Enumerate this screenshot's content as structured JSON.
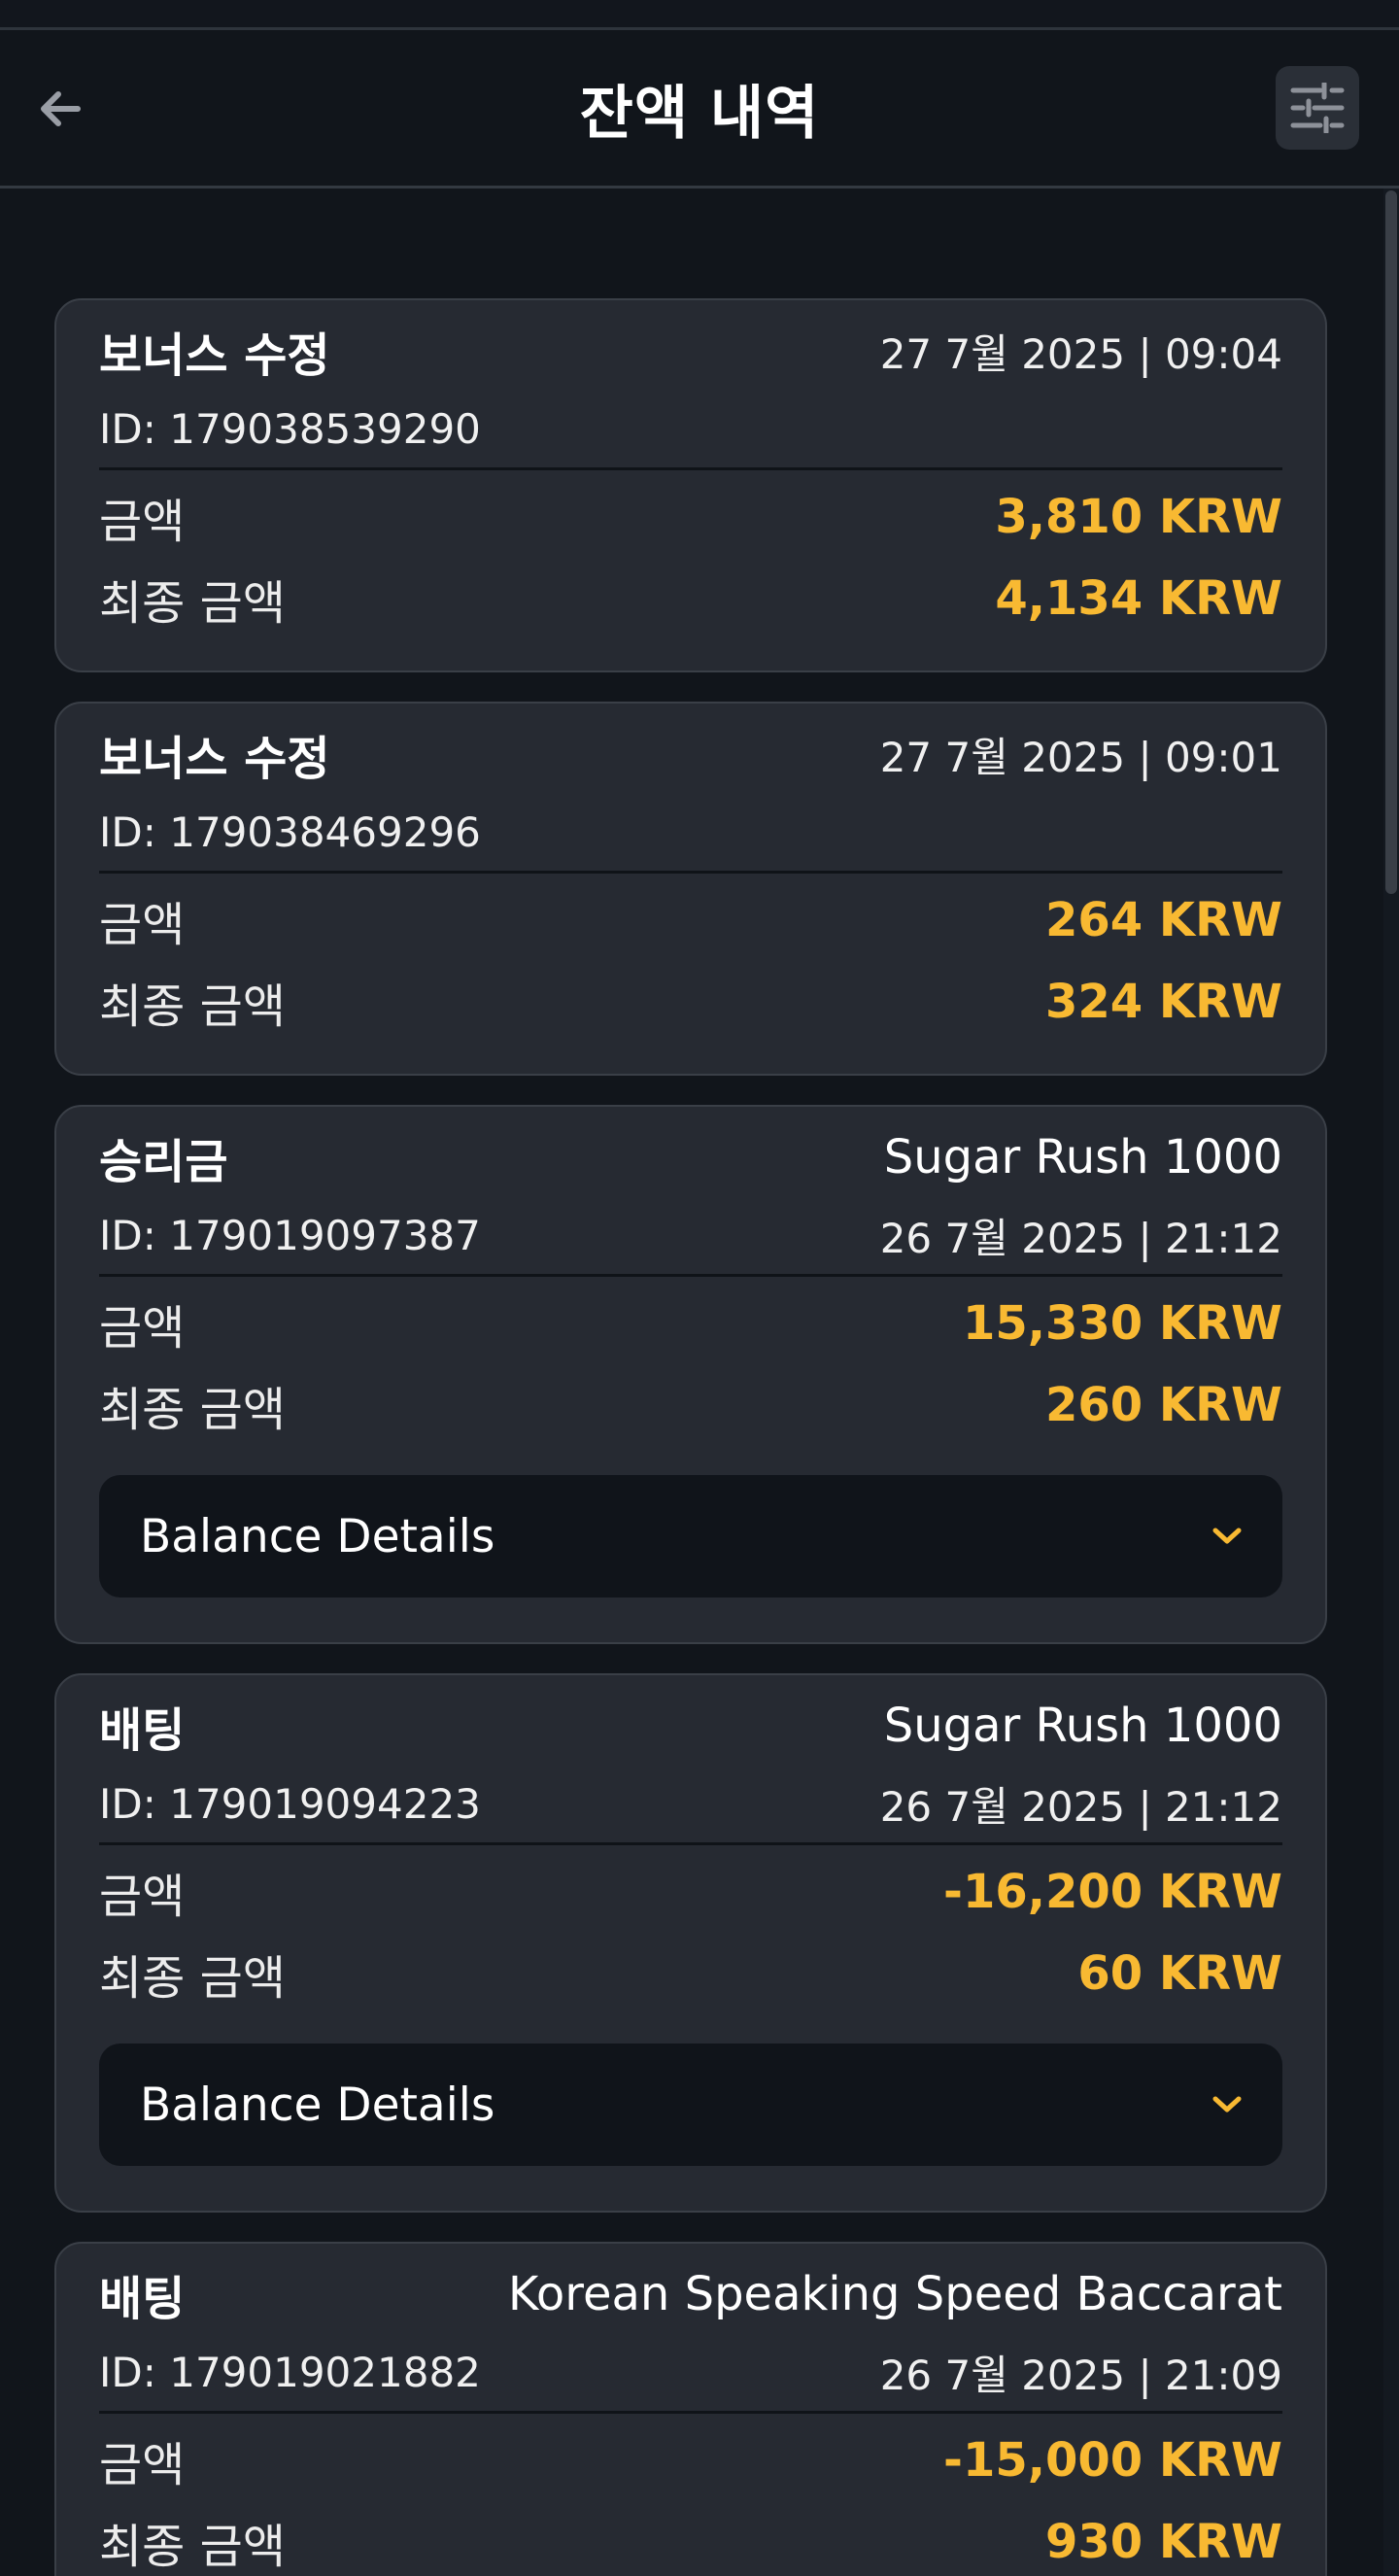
{
  "header": {
    "title": "잔액 내역",
    "back_icon": "arrow-left-icon",
    "filter_icon": "sliders-icon"
  },
  "colors": {
    "background": "#11151b",
    "card": "#262a32",
    "accent_amount": "#f8b932",
    "details_bar": "#10141a"
  },
  "transactions": [
    {
      "type": "보너스 수정",
      "game": "",
      "id_text": "ID: 179038539290",
      "date": "27 7월 2025 | 09:04",
      "amount_label": "금액",
      "amount": "3,810 KRW",
      "final_label": "최종 금액",
      "final_amount": "4,134 KRW",
      "details_label": ""
    },
    {
      "type": "보너스 수정",
      "game": "",
      "id_text": "ID: 179038469296",
      "date": "27 7월 2025 | 09:01",
      "amount_label": "금액",
      "amount": "264 KRW",
      "final_label": "최종 금액",
      "final_amount": "324 KRW",
      "details_label": ""
    },
    {
      "type": "승리금",
      "game": "Sugar Rush 1000",
      "id_text": "ID: 179019097387",
      "date": "26 7월 2025 | 21:12",
      "amount_label": "금액",
      "amount": "15,330 KRW",
      "final_label": "최종 금액",
      "final_amount": "260 KRW",
      "details_label": "Balance Details"
    },
    {
      "type": "배팅",
      "game": "Sugar Rush 1000",
      "id_text": "ID: 179019094223",
      "date": "26 7월 2025 | 21:12",
      "amount_label": "금액",
      "amount": "-16,200 KRW",
      "final_label": "최종 금액",
      "final_amount": "60 KRW",
      "details_label": "Balance Details"
    },
    {
      "type": "배팅",
      "game": "Korean Speaking Speed Baccarat",
      "id_text": "ID: 179019021882",
      "date": "26 7월 2025 | 21:09",
      "amount_label": "금액",
      "amount": "-15,000 KRW",
      "final_label": "최종 금액",
      "final_amount": "930 KRW",
      "details_label": ""
    }
  ]
}
